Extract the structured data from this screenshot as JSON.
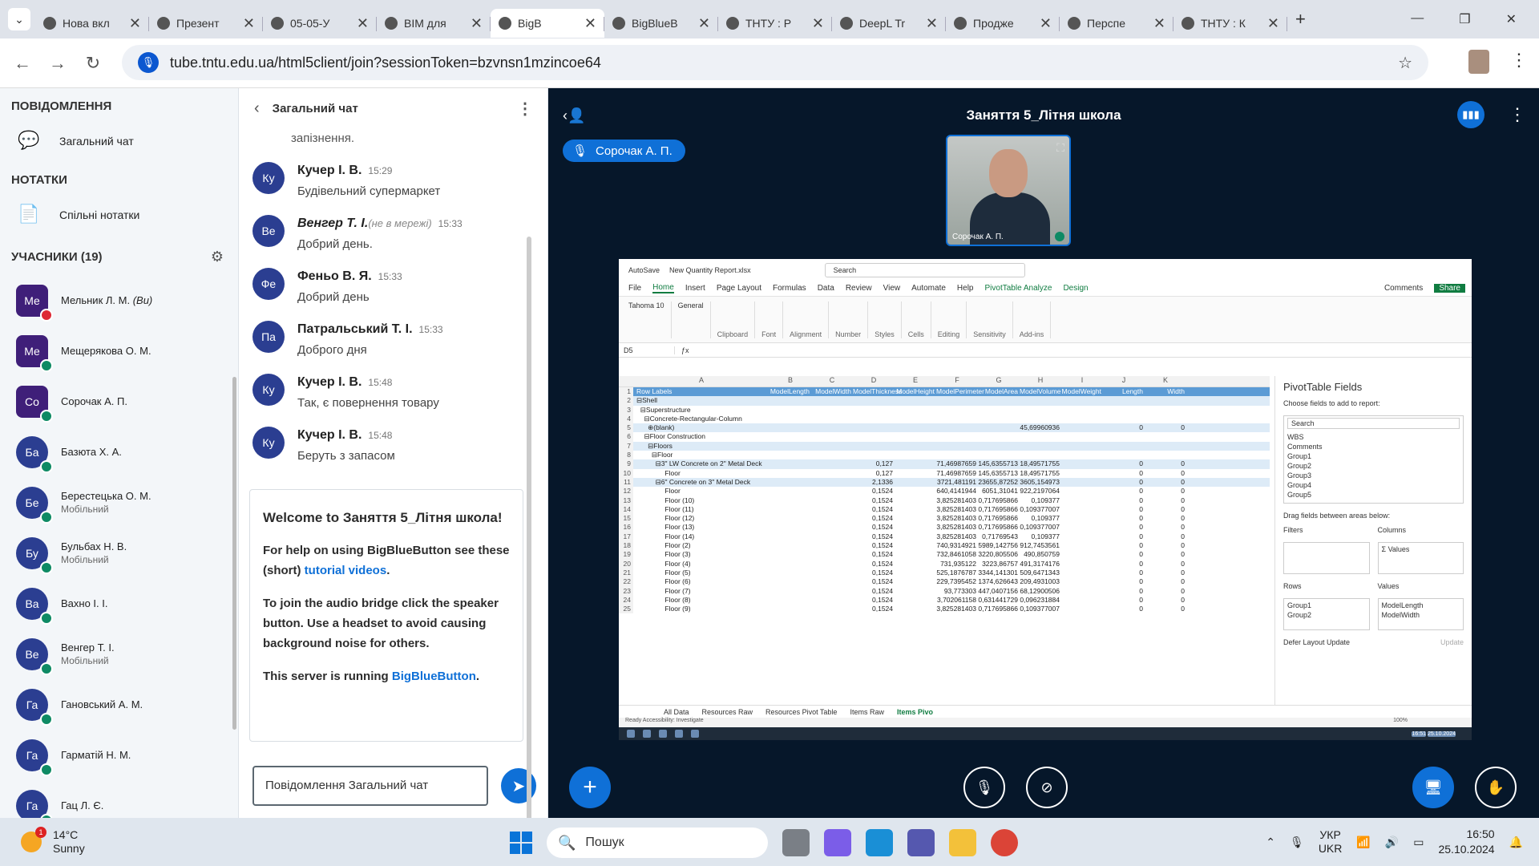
{
  "browser": {
    "tabs": [
      {
        "label": "Нова вкл",
        "icon": "chrome-icon"
      },
      {
        "label": "Презент",
        "icon": "gmail-icon"
      },
      {
        "label": "05-05-У",
        "icon": "globe-icon"
      },
      {
        "label": "BIM для",
        "icon": "at-icon"
      },
      {
        "label": "BigB",
        "icon": "bbb-icon",
        "active": true
      },
      {
        "label": "BigBlueB",
        "icon": "bbb-icon"
      },
      {
        "label": "ТНТУ : Р",
        "icon": "tntu-icon"
      },
      {
        "label": "DeepL Tr",
        "icon": "deepl-icon"
      },
      {
        "label": "Продже",
        "icon": "link-icon"
      },
      {
        "label": "Перспе",
        "icon": "openai-icon"
      },
      {
        "label": "ТНТУ : К",
        "icon": "tntu-icon"
      }
    ],
    "url": "tube.tntu.edu.ua/html5client/join?sessionToken=bzvnsn1mzincoe64"
  },
  "sidebar": {
    "messages_header": "ПОВІДОМЛЕННЯ",
    "public_chat": "Загальний чат",
    "notes_header": "НОТАТКИ",
    "shared_notes": "Спільні нотатки",
    "participants_header": "УЧАСНИКИ (19)",
    "users": [
      {
        "initials": "Ме",
        "name": "Мельник Л. М.",
        "suffix": "(Ви)",
        "sub": "",
        "muted": true,
        "shape": "square"
      },
      {
        "initials": "Ме",
        "name": "Мещерякова О. М.",
        "suffix": "",
        "sub": "",
        "shape": "square"
      },
      {
        "initials": "Со",
        "name": "Сорочак А. П.",
        "suffix": "",
        "sub": "",
        "shape": "square"
      },
      {
        "initials": "Ба",
        "name": "Базюта Х. А.",
        "suffix": "",
        "sub": "",
        "shape": "round"
      },
      {
        "initials": "Бе",
        "name": "Берестецька О. М.",
        "suffix": "",
        "sub": "Мобільний",
        "shape": "round"
      },
      {
        "initials": "Бу",
        "name": "Бульбах Н. В.",
        "suffix": "",
        "sub": "Мобільний",
        "shape": "round"
      },
      {
        "initials": "Ва",
        "name": "Вахно І. І.",
        "suffix": "",
        "sub": "",
        "shape": "round"
      },
      {
        "initials": "Ве",
        "name": "Венгер Т. І.",
        "suffix": "",
        "sub": "Мобільний",
        "shape": "round"
      },
      {
        "initials": "Га",
        "name": "Гановський А. М.",
        "suffix": "",
        "sub": "",
        "shape": "round"
      },
      {
        "initials": "Га",
        "name": "Гарматій Н. М.",
        "suffix": "",
        "sub": "",
        "shape": "round"
      },
      {
        "initials": "Га",
        "name": "Гац Л. Є.",
        "suffix": "",
        "sub": "",
        "shape": "round"
      }
    ]
  },
  "chat": {
    "title": "Загальний чат",
    "continuation": "запізнення.",
    "messages": [
      {
        "initials": "Ку",
        "author": "Кучер І. В.",
        "offline": "",
        "time": "15:29",
        "text": "Будівельний супермаркет"
      },
      {
        "initials": "Ве",
        "author": "Венгер Т. І.",
        "offline": "(не в мережі)",
        "time": "15:33",
        "text": "Добрий день."
      },
      {
        "initials": "Фе",
        "author": "Феньо В. Я.",
        "offline": "",
        "time": "15:33",
        "text": "Добрий день"
      },
      {
        "initials": "Па",
        "author": "Патральський Т. І.",
        "offline": "",
        "time": "15:33",
        "text": "Доброго дня"
      },
      {
        "initials": "Ку",
        "author": "Кучер І. В.",
        "offline": "",
        "time": "15:48",
        "text": "Так, є повернення товару"
      },
      {
        "initials": "Ку",
        "author": "Кучер І. В.",
        "offline": "",
        "time": "15:48",
        "text": "Беруть з запасом"
      }
    ],
    "welcome": {
      "prefix": "Welcome to ",
      "meeting": "Заняття 5_Літня школа",
      "suffix": "!",
      "help_text": "For help on using BigBlueButton see these (short) ",
      "help_link": "tutorial videos",
      "audio_text": "To join the audio bridge click the speaker button. Use a headset to avoid causing background noise for others.",
      "server_text": "This server is running ",
      "server_link": "BigBlueButton"
    },
    "input_placeholder": "Повідомлення Загальний чат"
  },
  "meeting": {
    "title": "Заняття 5_Літня школа",
    "talking": "Сорочак А. П.",
    "camera_name": "Сорочак А. П."
  },
  "excel": {
    "autosave": "AutoSave",
    "filename": "New Quantity Report.xlsx",
    "search": "Search",
    "menu": [
      "File",
      "Home",
      "Insert",
      "Page Layout",
      "Formulas",
      "Data",
      "Review",
      "View",
      "Automate",
      "Help",
      "PivotTable Analyze",
      "Design"
    ],
    "comments": "Comments",
    "share": "Share",
    "ribbon_groups": [
      "Clipboard",
      "Font",
      "Alignment",
      "Number",
      "Styles",
      "Cells",
      "Editing",
      "Sensitivity",
      "Add-ins"
    ],
    "font": "Tahoma",
    "font_size": "10",
    "number_format": "General",
    "cell_ref": "D5",
    "columns": [
      "A",
      "B",
      "C",
      "D",
      "E",
      "F",
      "G",
      "H",
      "I",
      "J",
      "K"
    ],
    "header_row": [
      "Row Labels",
      "ModelLength",
      "ModelWidth",
      "ModelThickness",
      "ModelHeight",
      "ModelPerimeter",
      "ModelArea",
      "ModelVolume",
      "ModelWeight",
      "Length",
      "Width"
    ],
    "rows": [
      {
        "n": "2",
        "label": "⊟Shell",
        "v": [
          "",
          "",
          "",
          "",
          "",
          "",
          "",
          "",
          "",
          ""
        ],
        "hl": true
      },
      {
        "n": "3",
        "label": "  ⊟Superstructure",
        "v": [
          "",
          "",
          "",
          "",
          "",
          "",
          "",
          "",
          "",
          ""
        ]
      },
      {
        "n": "4",
        "label": "    ⊟Concrete-Rectangular-Column",
        "v": [
          "",
          "",
          "",
          "",
          "",
          "",
          "",
          "",
          "",
          ""
        ]
      },
      {
        "n": "5",
        "label": "      ⊕(blank)",
        "v": [
          "",
          "",
          "",
          "",
          "",
          "",
          "45,69960936",
          "",
          "0",
          "0"
        ],
        "hl": true
      },
      {
        "n": "6",
        "label": "    ⊟Floor Construction",
        "v": [
          "",
          "",
          "",
          "",
          "",
          "",
          "",
          "",
          "",
          ""
        ]
      },
      {
        "n": "7",
        "label": "      ⊟Floors",
        "v": [
          "",
          "",
          "",
          "",
          "",
          "",
          "",
          "",
          "",
          ""
        ],
        "hl": true
      },
      {
        "n": "8",
        "label": "        ⊟Floor",
        "v": [
          "",
          "",
          "",
          "",
          "",
          "",
          "",
          "",
          "",
          ""
        ]
      },
      {
        "n": "9",
        "label": "          ⊟3\" LW Concrete on 2\" Metal Deck",
        "v": [
          "",
          "",
          "0,127",
          "",
          "71,46987659",
          "145,6355713",
          "18,49571755",
          "",
          "0",
          "0"
        ],
        "hl": true
      },
      {
        "n": "10",
        "label": "               Floor",
        "v": [
          "",
          "",
          "0,127",
          "",
          "71,46987659",
          "145,6355713",
          "18,49571755",
          "",
          "0",
          "0"
        ]
      },
      {
        "n": "11",
        "label": "          ⊟6\" Concrete on 3\" Metal Deck",
        "v": [
          "",
          "",
          "2,1336",
          "",
          "3721,481191",
          "23655,87252",
          "3605,154973",
          "",
          "0",
          "0"
        ],
        "hl": true
      },
      {
        "n": "12",
        "label": "               Floor",
        "v": [
          "",
          "",
          "0,1524",
          "",
          "640,4141944",
          "6051,31041",
          "922,2197064",
          "",
          "0",
          "0"
        ]
      },
      {
        "n": "13",
        "label": "               Floor (10)",
        "v": [
          "",
          "",
          "0,1524",
          "",
          "3,825281403",
          "0,717695866",
          "0,109377",
          "",
          "0",
          "0"
        ]
      },
      {
        "n": "14",
        "label": "               Floor (11)",
        "v": [
          "",
          "",
          "0,1524",
          "",
          "3,825281403",
          "0,717695866",
          "0,109377007",
          "",
          "0",
          "0"
        ]
      },
      {
        "n": "15",
        "label": "               Floor (12)",
        "v": [
          "",
          "",
          "0,1524",
          "",
          "3,825281403",
          "0,717695866",
          "0,109377",
          "",
          "0",
          "0"
        ]
      },
      {
        "n": "16",
        "label": "               Floor (13)",
        "v": [
          "",
          "",
          "0,1524",
          "",
          "3,825281403",
          "0,717695866",
          "0,109377007",
          "",
          "0",
          "0"
        ]
      },
      {
        "n": "17",
        "label": "               Floor (14)",
        "v": [
          "",
          "",
          "0,1524",
          "",
          "3,825281403",
          "0,71769543",
          "0,109377",
          "",
          "0",
          "0"
        ]
      },
      {
        "n": "18",
        "label": "               Floor (2)",
        "v": [
          "",
          "",
          "0,1524",
          "",
          "740,9314921",
          "5989,142756",
          "912,7453561",
          "",
          "0",
          "0"
        ]
      },
      {
        "n": "19",
        "label": "               Floor (3)",
        "v": [
          "",
          "",
          "0,1524",
          "",
          "732,8461058",
          "3220,805506",
          "490,850759",
          "",
          "0",
          "0"
        ]
      },
      {
        "n": "20",
        "label": "               Floor (4)",
        "v": [
          "",
          "",
          "0,1524",
          "",
          "731,935122",
          "3223,86757",
          "491,3174176",
          "",
          "0",
          "0"
        ]
      },
      {
        "n": "21",
        "label": "               Floor (5)",
        "v": [
          "",
          "",
          "0,1524",
          "",
          "525,1876787",
          "3344,141301",
          "509,6471343",
          "",
          "0",
          "0"
        ]
      },
      {
        "n": "22",
        "label": "               Floor (6)",
        "v": [
          "",
          "",
          "0,1524",
          "",
          "229,7395452",
          "1374,626643",
          "209,4931003",
          "",
          "0",
          "0"
        ]
      },
      {
        "n": "23",
        "label": "               Floor (7)",
        "v": [
          "",
          "",
          "0,1524",
          "",
          "93,773303",
          "447,0407156",
          "68,12900506",
          "",
          "0",
          "0"
        ]
      },
      {
        "n": "24",
        "label": "               Floor (8)",
        "v": [
          "",
          "",
          "0,1524",
          "",
          "3,702061158",
          "0,631441729",
          "0,096231884",
          "",
          "0",
          "0"
        ]
      },
      {
        "n": "25",
        "label": "               Floor (9)",
        "v": [
          "",
          "",
          "0,1524",
          "",
          "3,825281403",
          "0,717695866",
          "0,109377007",
          "",
          "0",
          "0"
        ]
      }
    ],
    "pivot": {
      "title": "PivotTable Fields",
      "choose": "Choose fields to add to report:",
      "search": "Search",
      "fields": [
        "WBS",
        "Comments",
        "Group1",
        "Group2",
        "Group3",
        "Group4",
        "Group5"
      ],
      "drag": "Drag fields between areas below:",
      "filters": "Filters",
      "columns": "Columns",
      "col_value": "Σ Values",
      "rows": "Rows",
      "values": "Values",
      "row_items": [
        "Group1",
        "Group2"
      ],
      "value_items": [
        "ModelLength",
        "ModelWidth"
      ],
      "defer": "Defer Layout Update",
      "update": "Update"
    },
    "sheets": [
      "All Data",
      "Resources Raw",
      "Resources Pivot Table",
      "Items Raw",
      "Items Pivo"
    ],
    "status": "Ready   Accessibility: Investigate",
    "zoom": "100%",
    "time": "16:51",
    "date": "25.10.2024"
  },
  "taskbar": {
    "temp": "14°C",
    "weather": "Sunny",
    "notif": "1",
    "search": "Пошук",
    "lang1": "УКР",
    "lang2": "UKR",
    "time": "16:50",
    "date": "25.10.2024"
  }
}
